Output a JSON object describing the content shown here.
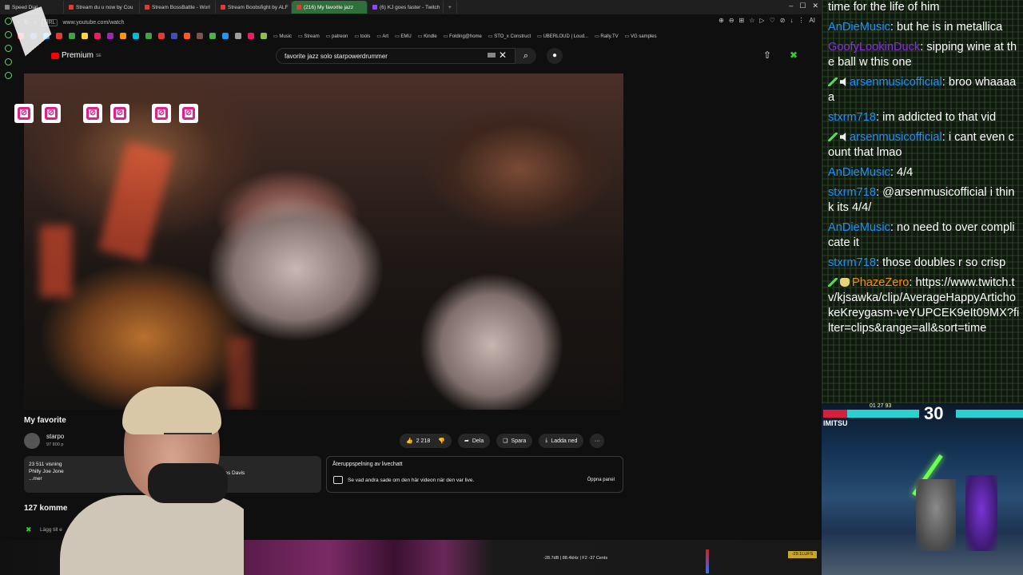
{
  "browser": {
    "tabs": [
      {
        "label": "Speed Dial",
        "favicon": "gr"
      },
      {
        "label": "Stream du u now by Cou",
        "favicon": ""
      },
      {
        "label": "Stream BossBattle - Worl",
        "favicon": ""
      },
      {
        "label": "Stream Boobsfight by ALF",
        "favicon": ""
      },
      {
        "label": "(216) My favorite jazz",
        "favicon": "",
        "active": true
      },
      {
        "label": "(6) KJ goes faster - Twitch",
        "favicon": "tw"
      }
    ],
    "new_tab": "+",
    "url": "www.youtube.com/watch",
    "url_prefix": "URL",
    "bookmarks": [
      "Music",
      "Stream",
      "patreon",
      "tools",
      "Art",
      "EMU",
      "Kindle",
      "Folding@home",
      "STO_x Construct",
      "UBERLOUD | Loud...",
      "Rally.TV",
      "VG samples"
    ],
    "bookmark_colors": [
      "#e53935",
      "#3f51b5",
      "#1da1f2",
      "#e53935",
      "#43a047",
      "#fdd835",
      "#e91e63",
      "#9c27b0",
      "#ff9800",
      "#00bcd4",
      "#43a047",
      "#e53935",
      "#3f51b5",
      "#ff5722",
      "#795548",
      "#4caf50",
      "#2196f3",
      "#9e9e9e",
      "#e91e63",
      "#8bc34a"
    ],
    "addr_icons": [
      "⊕",
      "⊖",
      "⊞",
      "☆",
      "▷",
      "♡",
      "⊘",
      "↓",
      "⋮",
      "AI"
    ]
  },
  "youtube": {
    "logo_text": "Premium",
    "logo_sup": "SE",
    "search_value": "favorite jazz solo starpowerdrummer",
    "search_icon": "⌕",
    "mic_icon": "🎙",
    "video_title": "My favorite",
    "channel_name": "starpo",
    "channel_subs": "97 800 p",
    "likes": "2 218",
    "share_label": "Dela",
    "save_label": "Spara",
    "download_label": "Ladda ned",
    "more_label": "···",
    "desc_views": "23 511 visning",
    "desc_line2": "Philly Joe Jone",
    "desc_more": "...mer",
    "desc_extra": "y Miles Davis",
    "chat_replay_title": "Återuppspelning av livechatt",
    "chat_replay_desc": "Se vad andra sade om den här videon när den var live.",
    "chat_replay_button": "Öppna panel",
    "comments_count": "127 komme",
    "add_comment": "Lägg till e"
  },
  "overlay": {
    "heart_count": 6
  },
  "audio": {
    "readout": "-28.7dB | 88.4kHz | F2  -37 Cents",
    "lufs": "-29.1LUFS"
  },
  "chat": {
    "messages": [
      {
        "user": "",
        "color": "#ffffff",
        "badges": [],
        "text": "time for the life of him"
      },
      {
        "user": "AnDieMusic",
        "color": "#1e90ff",
        "badges": [],
        "text": "but he is in metallica"
      },
      {
        "user": "GoofyLookinDuck",
        "color": "#8a2be2",
        "badges": [],
        "text": "sipping wine at the ball w this one"
      },
      {
        "user": "arsenmusicofficial",
        "color": "#1e90ff",
        "badges": [
          "sword",
          "speaker"
        ],
        "text": "broo whaaaaa"
      },
      {
        "user": "stxrm718",
        "color": "#1e90ff",
        "badges": [],
        "text": "im addicted to that vid"
      },
      {
        "user": "arsenmusicofficial",
        "color": "#1e90ff",
        "badges": [
          "sword",
          "speaker"
        ],
        "text": "i cant even count that lmao"
      },
      {
        "user": "AnDieMusic",
        "color": "#1e90ff",
        "badges": [],
        "text": "4/4"
      },
      {
        "user": "stxrm718",
        "color": "#1e90ff",
        "badges": [],
        "text": "@arsenmusicofficial i think its 4/4/"
      },
      {
        "user": "AnDieMusic",
        "color": "#1e90ff",
        "badges": [],
        "text": "no need to over complicate it"
      },
      {
        "user": "stxrm718",
        "color": "#1e90ff",
        "badges": [],
        "text": "those doubles r so crisp"
      },
      {
        "user": "PhazeZero",
        "color": "#ff8c00",
        "badges": [
          "sword",
          "bag"
        ],
        "text": "https://www.twitch.tv/kjsawka/clip/AverageHappyArtichokeKreygasm-veYUPCEK9eIt09MX?filter=clips&range=all&sort=time"
      }
    ]
  },
  "game": {
    "timer": "30",
    "fighter_name": "IMITSU",
    "top_numbers": "01 27 93"
  }
}
